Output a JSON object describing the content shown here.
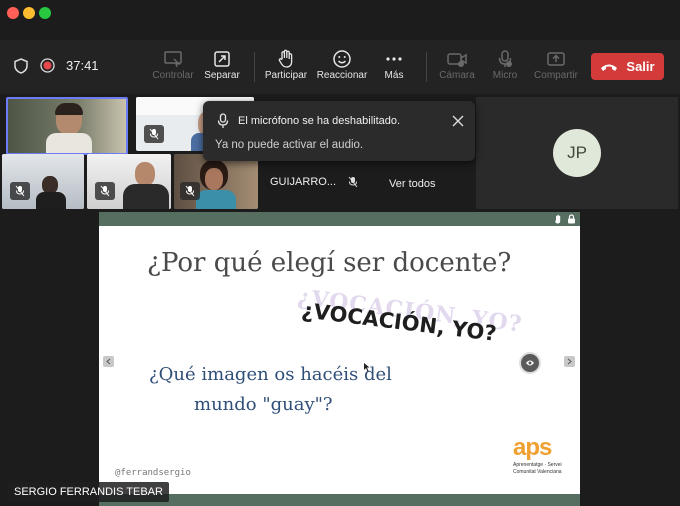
{
  "window": {
    "traffic_lights": [
      "#ff5f57",
      "#febc2e",
      "#28c840"
    ]
  },
  "toolbar": {
    "timer": "37:41",
    "items": [
      {
        "label": "Controlar",
        "icon": "screen-control-icon",
        "disabled": true
      },
      {
        "label": "Separar",
        "icon": "pop-out-icon",
        "disabled": false
      },
      {
        "label": "Participar",
        "icon": "raise-hand-icon",
        "disabled": false
      },
      {
        "label": "Reaccionar",
        "icon": "smiley-icon",
        "disabled": false
      },
      {
        "label": "Más",
        "icon": "more-icon",
        "disabled": false
      },
      {
        "label": "Cámara",
        "icon": "camera-off-icon",
        "disabled": true
      },
      {
        "label": "Micro",
        "icon": "mic-off-icon",
        "disabled": true
      },
      {
        "label": "Compartir",
        "icon": "share-icon",
        "disabled": true
      }
    ],
    "leave_label": "Salir",
    "leave_color": "#d33a3a"
  },
  "participants": {
    "guijarro": "GUIJARRO...",
    "see_all": "Ver todos",
    "avatar_initials": "JP"
  },
  "notification": {
    "title": "El micrófono se ha deshabilitado.",
    "subtitle": "Ya no puede activar el audio."
  },
  "slide": {
    "heading": "¿Por qué elegí ser docente?",
    "stamp": "¿VOCACIÓN, YO?",
    "question_line1": "¿Qué imagen os hacéis del",
    "question_line2": "mundo \"guay\"?",
    "handle": "@ferrandsergio",
    "logo_text": "aps",
    "logo_sub1": "Aprenentatge · Servei",
    "logo_sub2": "Comunitat Valenciana"
  },
  "speaker_name": "SERGIO FERRANDIS TEBAR"
}
